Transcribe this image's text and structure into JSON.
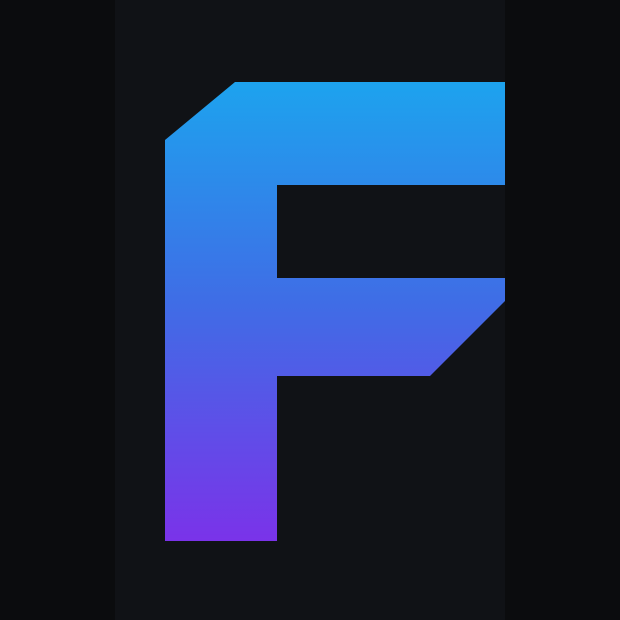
{
  "logo": {
    "icon": "letter-f-logo-icon",
    "gradient": {
      "top": "#1da3ee",
      "middle": "#3f6de6",
      "bottom": "#7a33e9"
    }
  },
  "colors": {
    "background": "#0b0c0e",
    "panel": "#101216"
  }
}
